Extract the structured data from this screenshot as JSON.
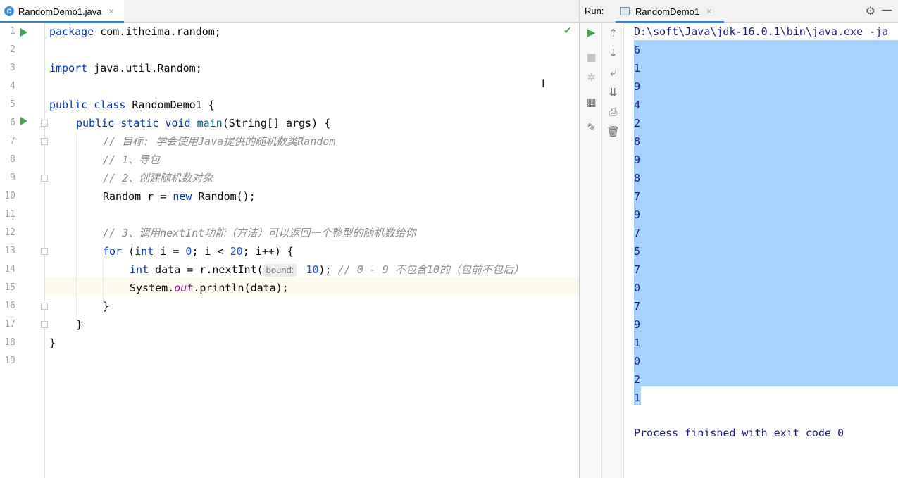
{
  "editor": {
    "tab": {
      "icon": "C",
      "label": "RandomDemo1.java",
      "close": "×"
    },
    "status_icon": "✔",
    "line_numbers": [
      "1",
      "2",
      "3",
      "4",
      "5",
      "6",
      "7",
      "8",
      "9",
      "10",
      "11",
      "12",
      "13",
      "14",
      "15",
      "16",
      "17",
      "18",
      "19"
    ],
    "lines": {
      "l1": {
        "kw": "package",
        "rest": " com.itheima.random;"
      },
      "l3": {
        "kw": "import",
        "rest": " java.util.Random;"
      },
      "l5": {
        "kw": "public class",
        "rest": " RandomDemo1 {"
      },
      "l6": {
        "kw": "public static void",
        "name": " main",
        "rest": "(String[] args) {"
      },
      "l7": {
        "comment": "// 目标: 学会使用Java提供的随机数类Random"
      },
      "l8": {
        "comment": "// 1、导包"
      },
      "l9": {
        "comment": "// 2、创建随机数对象"
      },
      "l10": {
        "pre": "Random r = ",
        "kw": "new",
        "rest": " Random();"
      },
      "l12": {
        "comment": "// 3、调用nextInt功能（方法）可以返回一个整型的随机数给你"
      },
      "l13": {
        "kw": "for",
        "p1": " (",
        "kw2": "int",
        "var": " i",
        "p2": " = ",
        "n1": "0",
        "p3": "; ",
        "var2": "i",
        "p4": " < ",
        "n2": "20",
        "p5": "; ",
        "var3": "i",
        "p6": "++) {"
      },
      "l14": {
        "kw": "int",
        "pre": " data = r.nextInt(",
        "hint": "bound:",
        "num": " 10",
        "post": "); ",
        "comment": "// 0 - 9 不包含10的（包前不包后）"
      },
      "l15": {
        "pre": "System.",
        "field": "out",
        "rest": ".println(data);"
      },
      "l16": {
        "text": "}"
      },
      "l17": {
        "text": "}"
      },
      "l18": {
        "text": "}"
      }
    }
  },
  "run": {
    "label": "Run:",
    "tab_label": "RandomDemo1",
    "tab_close": "×",
    "settings_icon": "⚙",
    "minimize_icon": "—",
    "toolbar_left": [
      "▶",
      "■",
      "✲",
      "▦",
      "✎"
    ],
    "toolbar_right": [
      "↑",
      "↓",
      "⤶",
      "⇊",
      "⎙",
      "🗑"
    ],
    "command": "D:\\soft\\Java\\jdk-16.0.1\\bin\\java.exe -ja",
    "output": [
      "6",
      "1",
      "9",
      "4",
      "2",
      "8",
      "9",
      "8",
      "7",
      "9",
      "7",
      "5",
      "7",
      "0",
      "7",
      "9",
      "1",
      "0",
      "2",
      "1"
    ],
    "finished": "Process finished with exit code 0"
  },
  "colors": {
    "keyword": "#0033b3",
    "comment": "#8c8c8c",
    "number": "#1750eb",
    "console_text": "#1a1a80",
    "selection": "#a6d2ff",
    "run_green": "#3ea64c",
    "tab_accent": "#4083c9"
  }
}
